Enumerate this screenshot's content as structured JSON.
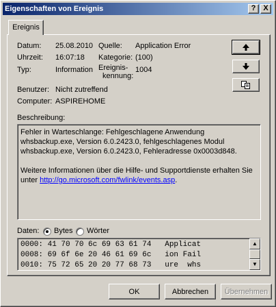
{
  "window": {
    "title": "Eigenschaften von Ereignis",
    "help_btn": "?",
    "close_btn": "X"
  },
  "tabs": [
    "Ereignis"
  ],
  "fields": {
    "datum": {
      "label": "Datum:",
      "value": "25.08.2010"
    },
    "uhrzeit": {
      "label": "Uhrzeit:",
      "value": "16:07:18"
    },
    "typ": {
      "label": "Typ:",
      "value": "Information"
    },
    "benutzer": {
      "label": "Benutzer:",
      "value": "Nicht zutreffend"
    },
    "computer": {
      "label": "Computer:",
      "value": "ASPIREHOME"
    },
    "quelle": {
      "label": "Quelle:",
      "value": "Application Error"
    },
    "kategorie": {
      "label": "Kategorie:",
      "value": "(100)"
    },
    "ereignis_label_1": "Ereignis-",
    "ereignis_label_2": "kennung:",
    "ereignis_value": "1004"
  },
  "nav_buttons": [
    "up-arrow-icon",
    "down-arrow-icon",
    "copy-icon"
  ],
  "beschreibung": {
    "label": "Beschreibung:",
    "para1": "Fehler in Warteschlange: Fehlgeschlagene Anwendung whsbackup.exe, Version 6.0.2423.0, fehlgeschlagenes Modul whsbackup.exe, Version 6.0.2423.0, Fehleradresse 0x0003d848.",
    "para2_prefix": "Weitere Informationen über die Hilfe- und Supportdienste erhalten Sie unter ",
    "link": "http://go.microsoft.com/fwlink/events.asp",
    "para2_suffix": "."
  },
  "daten": {
    "label": "Daten:",
    "option_bytes": "Bytes",
    "option_woerter": "Wörter",
    "selected": "Bytes",
    "rows": [
      "0000: 41 70 70 6c 69 63 61 74   Applicat",
      "0008: 69 6f 6e 20 46 61 69 6c   ion Fail",
      "0010: 75 72 65 20 20 77 68 73   ure  whs"
    ]
  },
  "footer": {
    "ok": "OK",
    "cancel": "Abbrechen",
    "apply": "Übernehmen"
  }
}
